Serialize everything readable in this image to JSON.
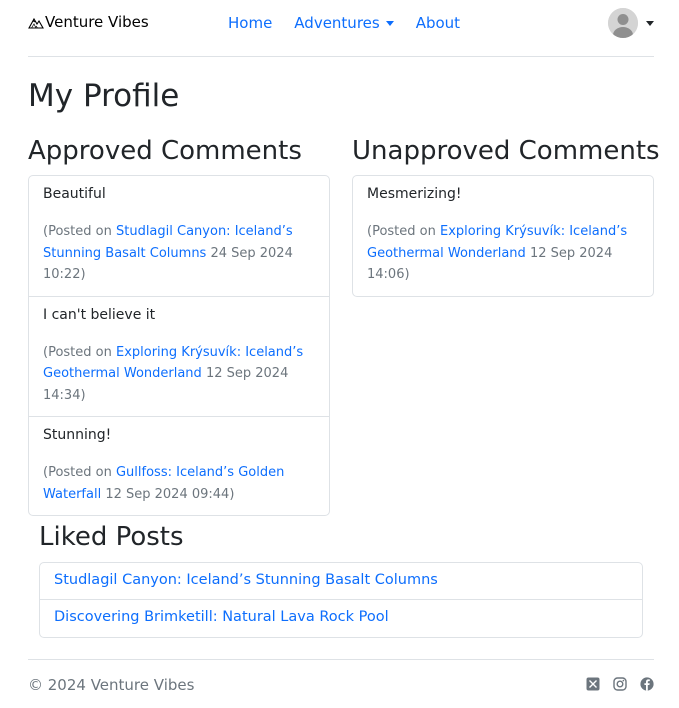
{
  "brand": {
    "icon": "mountain-icon",
    "name": "Venture Vibes"
  },
  "nav": {
    "home": "Home",
    "adventures": "Adventures",
    "about": "About"
  },
  "page": {
    "title": "My Profile"
  },
  "approved": {
    "title": "Approved Comments",
    "comments": [
      {
        "text": "Beautiful",
        "prefix": "(Posted on ",
        "post": "Studlagil Canyon: Iceland’s Stunning Basalt Columns",
        "date": " 24 Sep 2024 10:22)"
      },
      {
        "text": "I can't believe it",
        "prefix": "(Posted on ",
        "post": "Exploring Krýsuvík: Iceland’s Geothermal Wonderland",
        "date": " 12 Sep 2024 14:34)"
      },
      {
        "text": "Stunning!",
        "prefix": "(Posted on ",
        "post": "Gullfoss: Iceland’s Golden Waterfall",
        "date": " 12 Sep 2024 09:44)"
      }
    ]
  },
  "unapproved": {
    "title": "Unapproved Comments",
    "comments": [
      {
        "text": "Mesmerizing!",
        "prefix": "(Posted on ",
        "post": "Exploring Krýsuvík: Iceland’s Geothermal Wonderland",
        "date": " 12 Sep 2024 14:06)"
      }
    ]
  },
  "liked": {
    "title": "Liked Posts",
    "posts": [
      "Studlagil Canyon: Iceland’s Stunning Basalt Columns",
      "Discovering Brimketill: Natural Lava Rock Pool"
    ]
  },
  "footer": {
    "copyright": "© 2024 Venture Vibes",
    "social_icons": [
      "x-twitter-icon",
      "instagram-icon",
      "facebook-icon"
    ]
  },
  "colors": {
    "link": "#0d6efd",
    "muted": "#6c757d",
    "border": "#dee2e6"
  }
}
